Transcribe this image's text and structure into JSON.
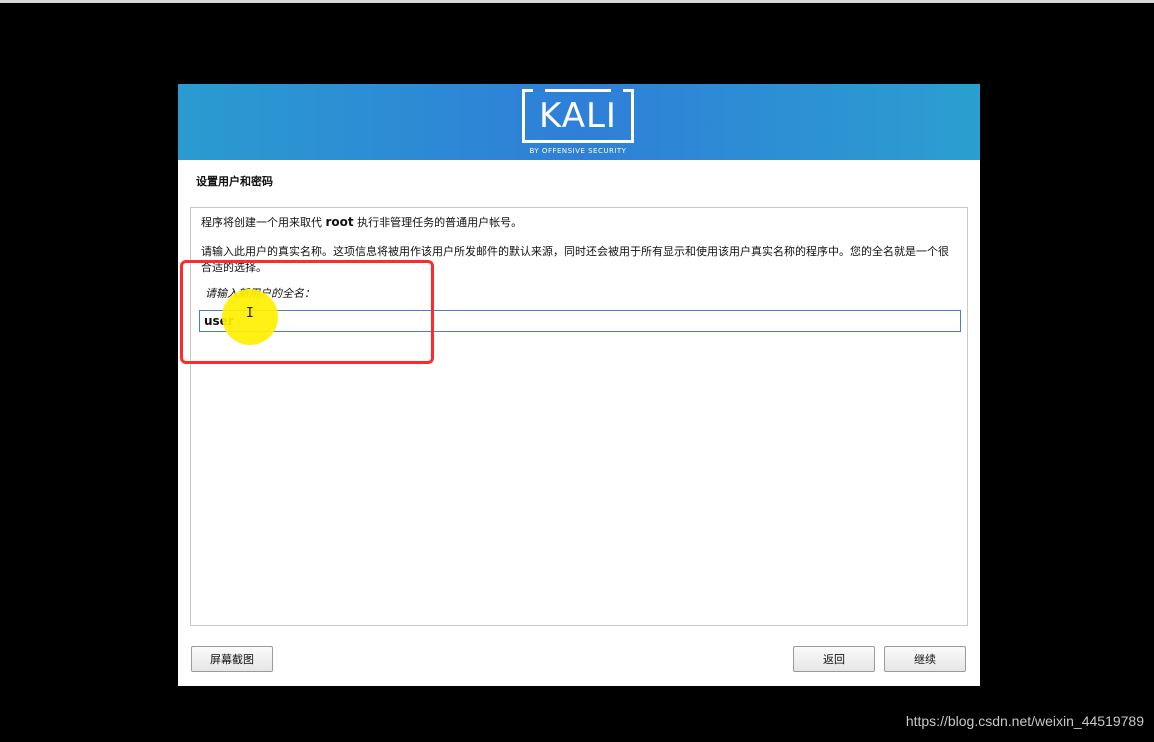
{
  "branding": {
    "logo_text": "KALI",
    "logo_subtitle": "BY OFFENSIVE SECURITY"
  },
  "page": {
    "step_title": "设置用户和密码",
    "intro_before": "程序将创建一个用来取代",
    "intro_root": "root",
    "intro_after": "执行非管理任务的普通用户帐号。",
    "description": "请输入此用户的真实名称。这项信息将被用作该用户所发邮件的默认来源，同时还会被用于所有显示和使用该用户真实名称的程序中。您的全名就是一个很合适的选择。",
    "field_label": "请输入新用户的全名："
  },
  "fullname_input": {
    "value": "user"
  },
  "buttons": {
    "screenshot": "屏幕截图",
    "back": "返回",
    "continue": "继续"
  },
  "watermark": "https://blog.csdn.net/weixin_44519789",
  "colors": {
    "banner_start": "#2a9bd0",
    "banner_mid": "#2f7fd8",
    "annotation_red": "#ff2a2a",
    "cursor_highlight": "#fff000"
  }
}
